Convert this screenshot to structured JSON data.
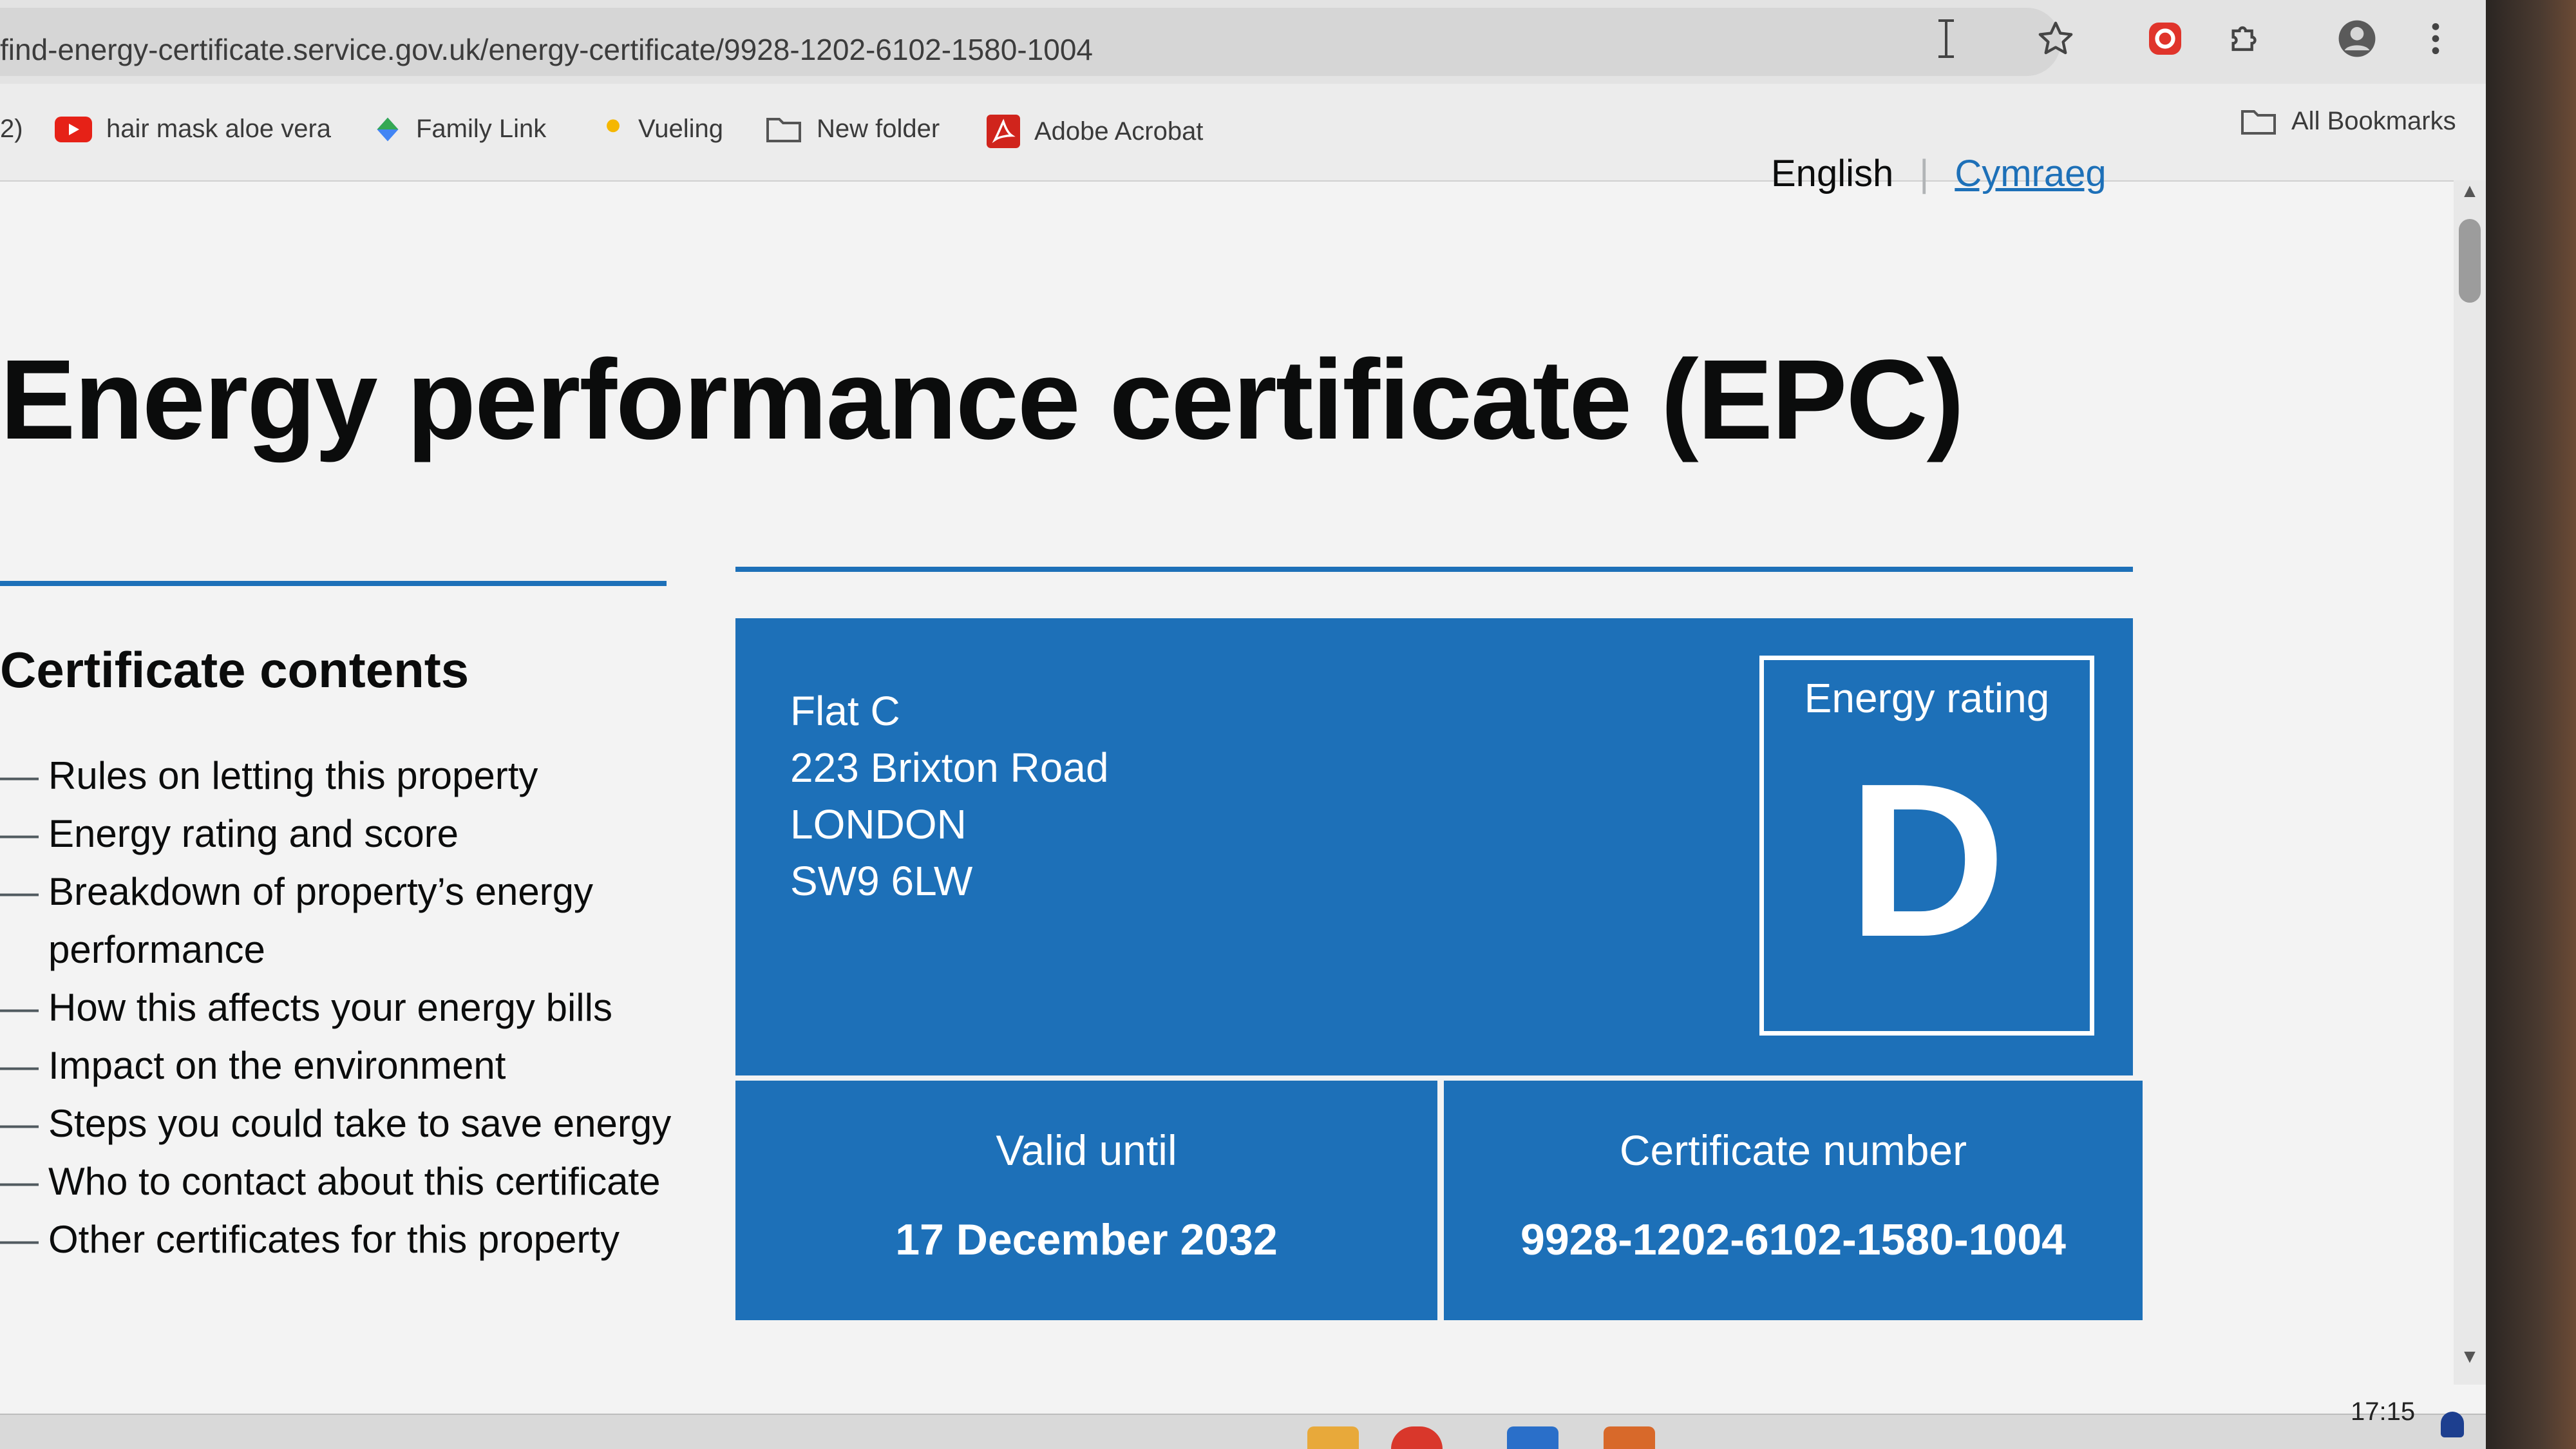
{
  "browser": {
    "url": "find-energy-certificate.service.gov.uk/energy-certificate/9928-1202-6102-1580-1004",
    "bookmarks": [
      {
        "label": "hair mask aloe vera",
        "icon": "youtube-icon"
      },
      {
        "label": "Family Link",
        "icon": "family-link-icon"
      },
      {
        "label": "Vueling",
        "icon": "vueling-dot-icon"
      },
      {
        "label": "New folder",
        "icon": "folder-icon"
      },
      {
        "label": "Adobe Acrobat",
        "icon": "acrobat-icon"
      }
    ],
    "all_bookmarks_label": "All Bookmarks",
    "bookmark_overflow_fragment": "2)"
  },
  "language": {
    "english": "English",
    "welsh": "Cymraeg"
  },
  "page": {
    "title": "Energy performance certificate (EPC)"
  },
  "contents": {
    "heading": "Certificate contents",
    "items": [
      "Rules on letting this property",
      "Energy rating and score",
      "Breakdown of property’s energy performance",
      "How this affects your energy bills",
      "Impact on the environment",
      "Steps you could take to save energy",
      "Who to contact about this certificate",
      "Other certificates for this property"
    ]
  },
  "certificate": {
    "address_lines": [
      "Flat C",
      "223 Brixton Road",
      "LONDON",
      "SW9 6LW"
    ],
    "energy_rating_label": "Energy rating",
    "energy_rating": "D",
    "valid_until_label": "Valid until",
    "valid_until": "17 December 2032",
    "certificate_number_label": "Certificate number",
    "certificate_number": "9928-1202-6102-1580-1004"
  },
  "taskbar": {
    "time": "17:15"
  },
  "colors": {
    "govuk_blue": "#1d70b8",
    "text": "#0b0c0c"
  }
}
